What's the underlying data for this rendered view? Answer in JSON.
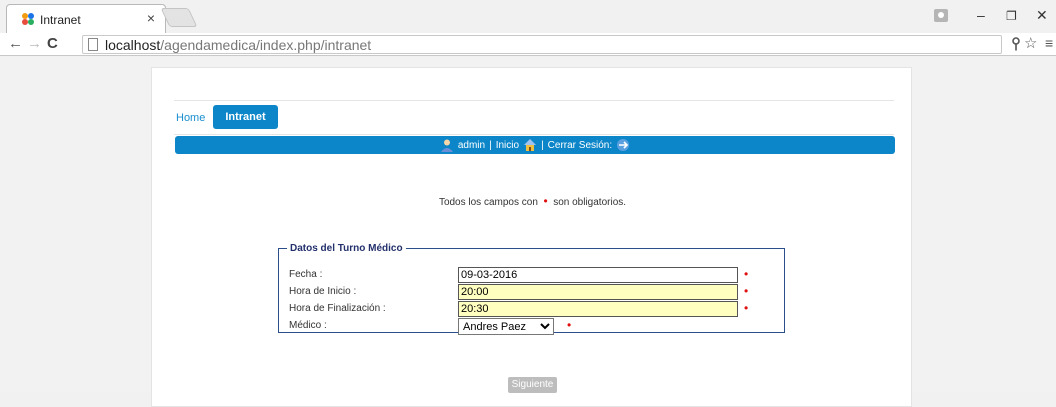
{
  "browser": {
    "tab_title": "Intranet",
    "tab_close": "×",
    "url_host": "localhost",
    "url_path": "/agendamedica/index.php/intranet",
    "window_controls": {
      "minimize": "–",
      "restore": "❐",
      "close": "✕"
    }
  },
  "nav": {
    "home_label": "Home",
    "intranet_label": "Intranet"
  },
  "userbar": {
    "user": "admin",
    "sep1": "|",
    "inicio": "Inicio",
    "sep2": "|",
    "logout": "Cerrar Sesión:"
  },
  "form": {
    "required_note_before": "Todos los campos con",
    "required_note_after": "son obligatorios.",
    "required_mark": "•",
    "legend": "Datos del Turno Médico",
    "fields": [
      {
        "label": "Fecha :",
        "value": "09-03-2016"
      },
      {
        "label": "Hora de Inicio :",
        "value": "20:00"
      },
      {
        "label": "Hora de Finalización :",
        "value": "20:30"
      },
      {
        "label": "Médico :",
        "value": "Andres Paez"
      }
    ],
    "submit_label": "Siguiente"
  },
  "colors": {
    "accent": "#0c86c8",
    "required": "#e01010",
    "highlight_input": "#ffffc0"
  }
}
